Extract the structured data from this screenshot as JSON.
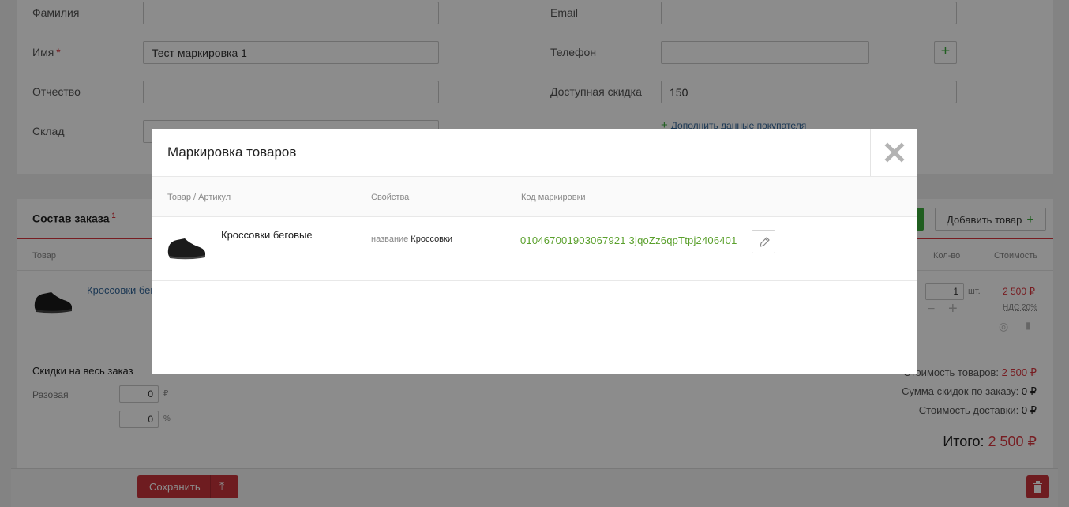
{
  "customer": {
    "last_name_label": "Фамилия",
    "last_name_value": "",
    "first_name_label": "Имя",
    "first_name_value": "Тест маркировка 1",
    "middle_name_label": "Отчество",
    "middle_name_value": "",
    "warehouse_label": "Склад",
    "email_label": "Email",
    "email_value": "",
    "phone_label": "Телефон",
    "phone_value": "",
    "discount_label": "Доступная скидка",
    "discount_value": "150",
    "add_data_link": "Дополнить данные покупателя"
  },
  "order": {
    "title": "Состав заказа",
    "title_sup": "1",
    "add_product_button": "Добавить товар",
    "col_product": "Товар",
    "col_qty": "Кол-во",
    "col_cost": "Стоимость",
    "item": {
      "name": "Кроссовки бег",
      "qty": "1",
      "unit": "шт.",
      "price": "2 500 ₽",
      "vat": "НДС 20%"
    }
  },
  "discounts": {
    "title": "Скидки на весь заказ",
    "onetime_label": "Разовая",
    "rub_value": "0",
    "rub_unit": "₽",
    "pct_value": "0",
    "pct_unit": "%"
  },
  "totals": {
    "goods_label": "Стоимость товаров:",
    "goods_value": "2 500 ₽",
    "discount_label": "Сумма скидок по заказу:",
    "discount_value": "0 ₽",
    "delivery_label": "Стоимость доставки:",
    "delivery_value": "0 ₽",
    "total_label": "Итого:",
    "total_value": "2 500 ₽"
  },
  "bottom": {
    "save_button": "Сохранить"
  },
  "modal": {
    "title": "Маркировка товаров",
    "col_product": "Товар / Артикул",
    "col_props": "Свойства",
    "col_code": "Код маркировки",
    "row": {
      "name": "Кроссовки беговые",
      "prop_key": "название",
      "prop_value": "Кроссовки",
      "code": "010467001903067921 3jqoZz6qpTtpj2406401"
    }
  },
  "colors": {
    "accent_red": "#c9343b",
    "accent_green": "#3bab3b",
    "code_green": "#5aa02c"
  }
}
